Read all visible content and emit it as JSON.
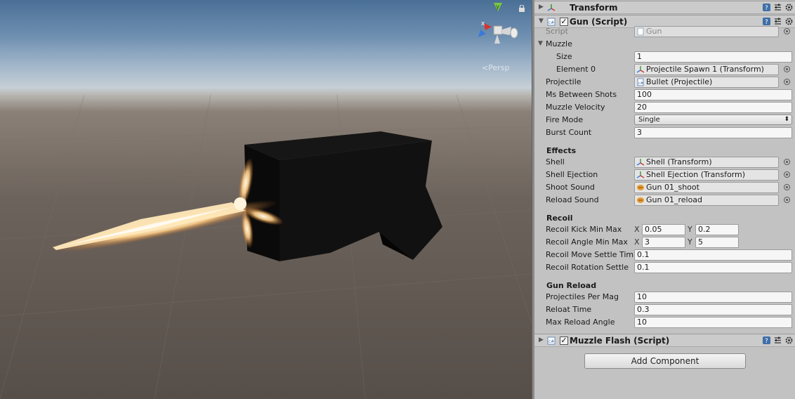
{
  "scene": {
    "persp_label": "Persp",
    "gizmo_axes": {
      "y": "y",
      "x": "x"
    }
  },
  "inspector": {
    "transform_header": {
      "title": "Transform"
    },
    "gun_header": {
      "title": "Gun (Script)",
      "enabled": true
    },
    "gun": {
      "script": {
        "label": "Script",
        "value": "Gun"
      },
      "muzzle": {
        "label": "Muzzle",
        "size": {
          "label": "Size",
          "value": "1"
        },
        "element0": {
          "label": "Element 0",
          "value": "Projectile Spawn 1 (Transform)"
        }
      },
      "projectile": {
        "label": "Projectile",
        "value": "Bullet (Projectile)"
      },
      "ms_between_shots": {
        "label": "Ms Between Shots",
        "value": "100"
      },
      "muzzle_velocity": {
        "label": "Muzzle Velocity",
        "value": "20"
      },
      "fire_mode": {
        "label": "Fire Mode",
        "value": "Single"
      },
      "burst_count": {
        "label": "Burst Count",
        "value": "3"
      },
      "effects": {
        "heading": "Effects",
        "shell": {
          "label": "Shell",
          "value": "Shell (Transform)"
        },
        "shell_ejection": {
          "label": "Shell Ejection",
          "value": "Shell Ejection (Transform)"
        },
        "shoot_sound": {
          "label": "Shoot Sound",
          "value": "Gun 01_shoot"
        },
        "reload_sound": {
          "label": "Reload Sound",
          "value": "Gun 01_reload"
        }
      },
      "recoil": {
        "heading": "Recoil",
        "kick": {
          "label": "Recoil Kick Min Max",
          "x_label": "X",
          "x": "0.05",
          "y_label": "Y",
          "y": "0.2"
        },
        "angle": {
          "label": "Recoil Angle Min Max",
          "x_label": "X",
          "x": "3",
          "y_label": "Y",
          "y": "5"
        },
        "move_settle": {
          "label": "Recoil Move Settle Tim",
          "value": "0.1"
        },
        "rotation_settle": {
          "label": "Recoil Rotation Settle",
          "value": "0.1"
        }
      },
      "reload": {
        "heading": "Gun Reload",
        "per_mag": {
          "label": "Projectiles Per Mag",
          "value": "10"
        },
        "time": {
          "label": "Reloat Time",
          "value": "0.3"
        },
        "max_angle": {
          "label": "Max Reload Angle",
          "value": "10"
        }
      }
    },
    "muzzle_flash_header": {
      "title": "Muzzle Flash (Script)",
      "enabled": true
    },
    "add_component": "Add Component"
  },
  "colors": {
    "inspector_bg": "#c2c2c2",
    "gizmo_y": "#7ac943",
    "gizmo_x": "#d9342b",
    "gizmo_z": "#3a7ad9",
    "muzzle_flash": "#ffe8b0"
  },
  "icons": {
    "transform": "axes-icon",
    "script": "cs-script-icon",
    "help": "help-book-icon",
    "preset": "preset-sliders-icon",
    "settings": "gear-icon",
    "object_picker": "circle-target-icon",
    "audio": "audio-clip-icon"
  }
}
